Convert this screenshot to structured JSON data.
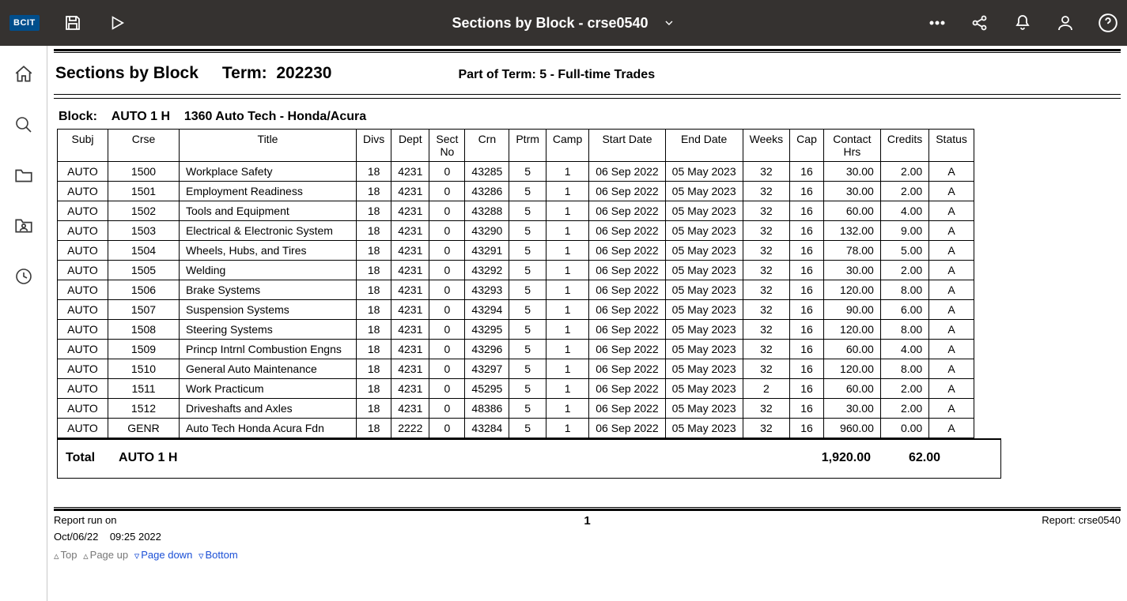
{
  "topbar": {
    "logo": "BCIT",
    "title": "Sections by Block - crse0540"
  },
  "header": {
    "page_title": "Sections by Block",
    "term_label": "Term:",
    "term_value": "202230",
    "pot_label": "Part of Term:",
    "pot_value": "5 - Full-time Trades"
  },
  "block": {
    "label": "Block:",
    "code": "AUTO 1 H",
    "desc": "1360 Auto Tech - Honda/Acura"
  },
  "columns": [
    "Subj",
    "Crse",
    "Title",
    "Divs",
    "Dept",
    "Sect No",
    "Crn",
    "Ptrm",
    "Camp",
    "Start Date",
    "End Date",
    "Weeks",
    "Cap",
    "Contact Hrs",
    "Credits",
    "Status"
  ],
  "rows": [
    {
      "subj": "AUTO",
      "crse": "1500",
      "title": "Workplace Safety",
      "divs": "18",
      "dept": "4231",
      "sect": "0",
      "crn": "43285",
      "ptrm": "5",
      "camp": "1",
      "start": "06 Sep 2022",
      "end": "05 May 2023",
      "weeks": "32",
      "cap": "16",
      "hrs": "30.00",
      "cred": "2.00",
      "stat": "A"
    },
    {
      "subj": "AUTO",
      "crse": "1501",
      "title": "Employment Readiness",
      "divs": "18",
      "dept": "4231",
      "sect": "0",
      "crn": "43286",
      "ptrm": "5",
      "camp": "1",
      "start": "06 Sep 2022",
      "end": "05 May 2023",
      "weeks": "32",
      "cap": "16",
      "hrs": "30.00",
      "cred": "2.00",
      "stat": "A"
    },
    {
      "subj": "AUTO",
      "crse": "1502",
      "title": "Tools and Equipment",
      "divs": "18",
      "dept": "4231",
      "sect": "0",
      "crn": "43288",
      "ptrm": "5",
      "camp": "1",
      "start": "06 Sep 2022",
      "end": "05 May 2023",
      "weeks": "32",
      "cap": "16",
      "hrs": "60.00",
      "cred": "4.00",
      "stat": "A"
    },
    {
      "subj": "AUTO",
      "crse": "1503",
      "title": "Electrical & Electronic System",
      "divs": "18",
      "dept": "4231",
      "sect": "0",
      "crn": "43290",
      "ptrm": "5",
      "camp": "1",
      "start": "06 Sep 2022",
      "end": "05 May 2023",
      "weeks": "32",
      "cap": "16",
      "hrs": "132.00",
      "cred": "9.00",
      "stat": "A"
    },
    {
      "subj": "AUTO",
      "crse": "1504",
      "title": "Wheels, Hubs, and Tires",
      "divs": "18",
      "dept": "4231",
      "sect": "0",
      "crn": "43291",
      "ptrm": "5",
      "camp": "1",
      "start": "06 Sep 2022",
      "end": "05 May 2023",
      "weeks": "32",
      "cap": "16",
      "hrs": "78.00",
      "cred": "5.00",
      "stat": "A"
    },
    {
      "subj": "AUTO",
      "crse": "1505",
      "title": "Welding",
      "divs": "18",
      "dept": "4231",
      "sect": "0",
      "crn": "43292",
      "ptrm": "5",
      "camp": "1",
      "start": "06 Sep 2022",
      "end": "05 May 2023",
      "weeks": "32",
      "cap": "16",
      "hrs": "30.00",
      "cred": "2.00",
      "stat": "A"
    },
    {
      "subj": "AUTO",
      "crse": "1506",
      "title": "Brake Systems",
      "divs": "18",
      "dept": "4231",
      "sect": "0",
      "crn": "43293",
      "ptrm": "5",
      "camp": "1",
      "start": "06 Sep 2022",
      "end": "05 May 2023",
      "weeks": "32",
      "cap": "16",
      "hrs": "120.00",
      "cred": "8.00",
      "stat": "A"
    },
    {
      "subj": "AUTO",
      "crse": "1507",
      "title": "Suspension Systems",
      "divs": "18",
      "dept": "4231",
      "sect": "0",
      "crn": "43294",
      "ptrm": "5",
      "camp": "1",
      "start": "06 Sep 2022",
      "end": "05 May 2023",
      "weeks": "32",
      "cap": "16",
      "hrs": "90.00",
      "cred": "6.00",
      "stat": "A"
    },
    {
      "subj": "AUTO",
      "crse": "1508",
      "title": "Steering Systems",
      "divs": "18",
      "dept": "4231",
      "sect": "0",
      "crn": "43295",
      "ptrm": "5",
      "camp": "1",
      "start": "06 Sep 2022",
      "end": "05 May 2023",
      "weeks": "32",
      "cap": "16",
      "hrs": "120.00",
      "cred": "8.00",
      "stat": "A"
    },
    {
      "subj": "AUTO",
      "crse": "1509",
      "title": "Princp Intrnl Combustion Engns",
      "divs": "18",
      "dept": "4231",
      "sect": "0",
      "crn": "43296",
      "ptrm": "5",
      "camp": "1",
      "start": "06 Sep 2022",
      "end": "05 May 2023",
      "weeks": "32",
      "cap": "16",
      "hrs": "60.00",
      "cred": "4.00",
      "stat": "A"
    },
    {
      "subj": "AUTO",
      "crse": "1510",
      "title": "General Auto Maintenance",
      "divs": "18",
      "dept": "4231",
      "sect": "0",
      "crn": "43297",
      "ptrm": "5",
      "camp": "1",
      "start": "06 Sep 2022",
      "end": "05 May 2023",
      "weeks": "32",
      "cap": "16",
      "hrs": "120.00",
      "cred": "8.00",
      "stat": "A"
    },
    {
      "subj": "AUTO",
      "crse": "1511",
      "title": "Work Practicum",
      "divs": "18",
      "dept": "4231",
      "sect": "0",
      "crn": "45295",
      "ptrm": "5",
      "camp": "1",
      "start": "06 Sep 2022",
      "end": "05 May 2023",
      "weeks": "2",
      "cap": "16",
      "hrs": "60.00",
      "cred": "2.00",
      "stat": "A"
    },
    {
      "subj": "AUTO",
      "crse": "1512",
      "title": "Driveshafts and Axles",
      "divs": "18",
      "dept": "4231",
      "sect": "0",
      "crn": "48386",
      "ptrm": "5",
      "camp": "1",
      "start": "06 Sep 2022",
      "end": "05 May 2023",
      "weeks": "32",
      "cap": "16",
      "hrs": "30.00",
      "cred": "2.00",
      "stat": "A"
    },
    {
      "subj": "AUTO",
      "crse": "GENR",
      "title": "Auto Tech Honda Acura Fdn",
      "divs": "18",
      "dept": "2222",
      "sect": "0",
      "crn": "43284",
      "ptrm": "5",
      "camp": "1",
      "start": "06 Sep 2022",
      "end": "05 May 2023",
      "weeks": "32",
      "cap": "16",
      "hrs": "960.00",
      "cred": "0.00",
      "stat": "A"
    }
  ],
  "totals": {
    "label": "Total",
    "block": "AUTO 1 H",
    "hrs": "1,920.00",
    "cred": "62.00"
  },
  "footer": {
    "run_label": "Report run on",
    "page": "1",
    "report_label": "Report: crse0540",
    "run_date": "Oct/06/22",
    "run_time": "09:25 2022"
  },
  "nav": {
    "top": "Top",
    "pageup": "Page up",
    "pagedown": "Page down",
    "bottom": "Bottom"
  }
}
